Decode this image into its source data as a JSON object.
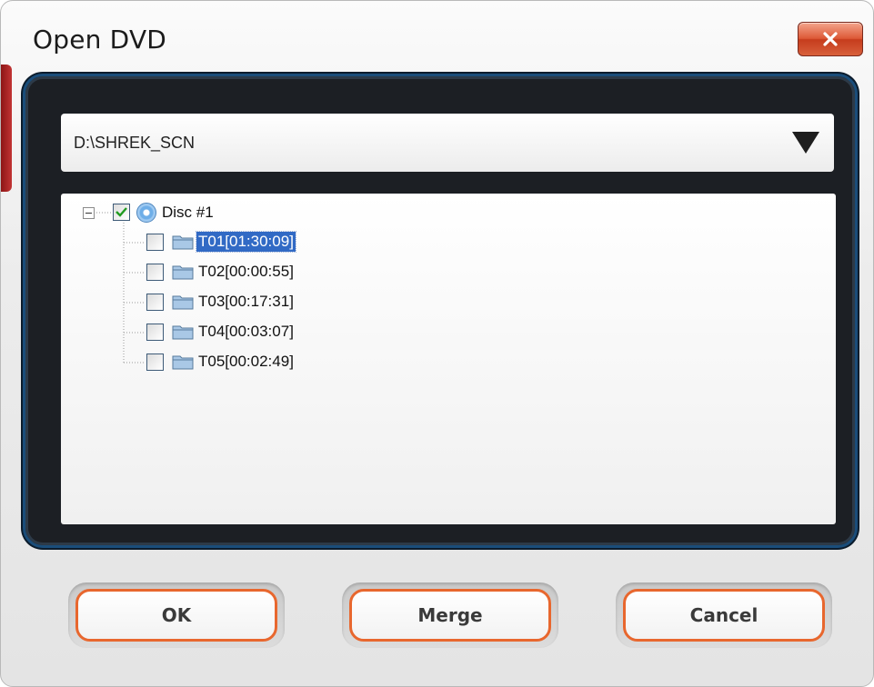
{
  "window": {
    "title": "Open DVD",
    "close_icon": "close-x-icon"
  },
  "path_combo": {
    "value": "D:\\SHREK_SCN",
    "arrow_icon": "triangle-down-icon"
  },
  "tree": {
    "root": {
      "label": "Disc #1",
      "checked": true,
      "expanded": true,
      "icon": "disc-icon"
    },
    "items": [
      {
        "label": "T01[01:30:09]",
        "checked": false,
        "selected": true,
        "icon": "folder-icon"
      },
      {
        "label": "T02[00:00:55]",
        "checked": false,
        "selected": false,
        "icon": "folder-icon"
      },
      {
        "label": "T03[00:17:31]",
        "checked": false,
        "selected": false,
        "icon": "folder-icon"
      },
      {
        "label": "T04[00:03:07]",
        "checked": false,
        "selected": false,
        "icon": "folder-icon"
      },
      {
        "label": "T05[00:02:49]",
        "checked": false,
        "selected": false,
        "icon": "folder-icon"
      }
    ]
  },
  "buttons": {
    "ok": "OK",
    "merge": "Merge",
    "cancel": "Cancel"
  },
  "colors": {
    "accent_orange": "#e8672e",
    "selection_blue": "#316ac5",
    "panel_dark": "#1c1f24",
    "panel_border_blue": "#1a4d7a",
    "close_red": "#d8603b"
  }
}
